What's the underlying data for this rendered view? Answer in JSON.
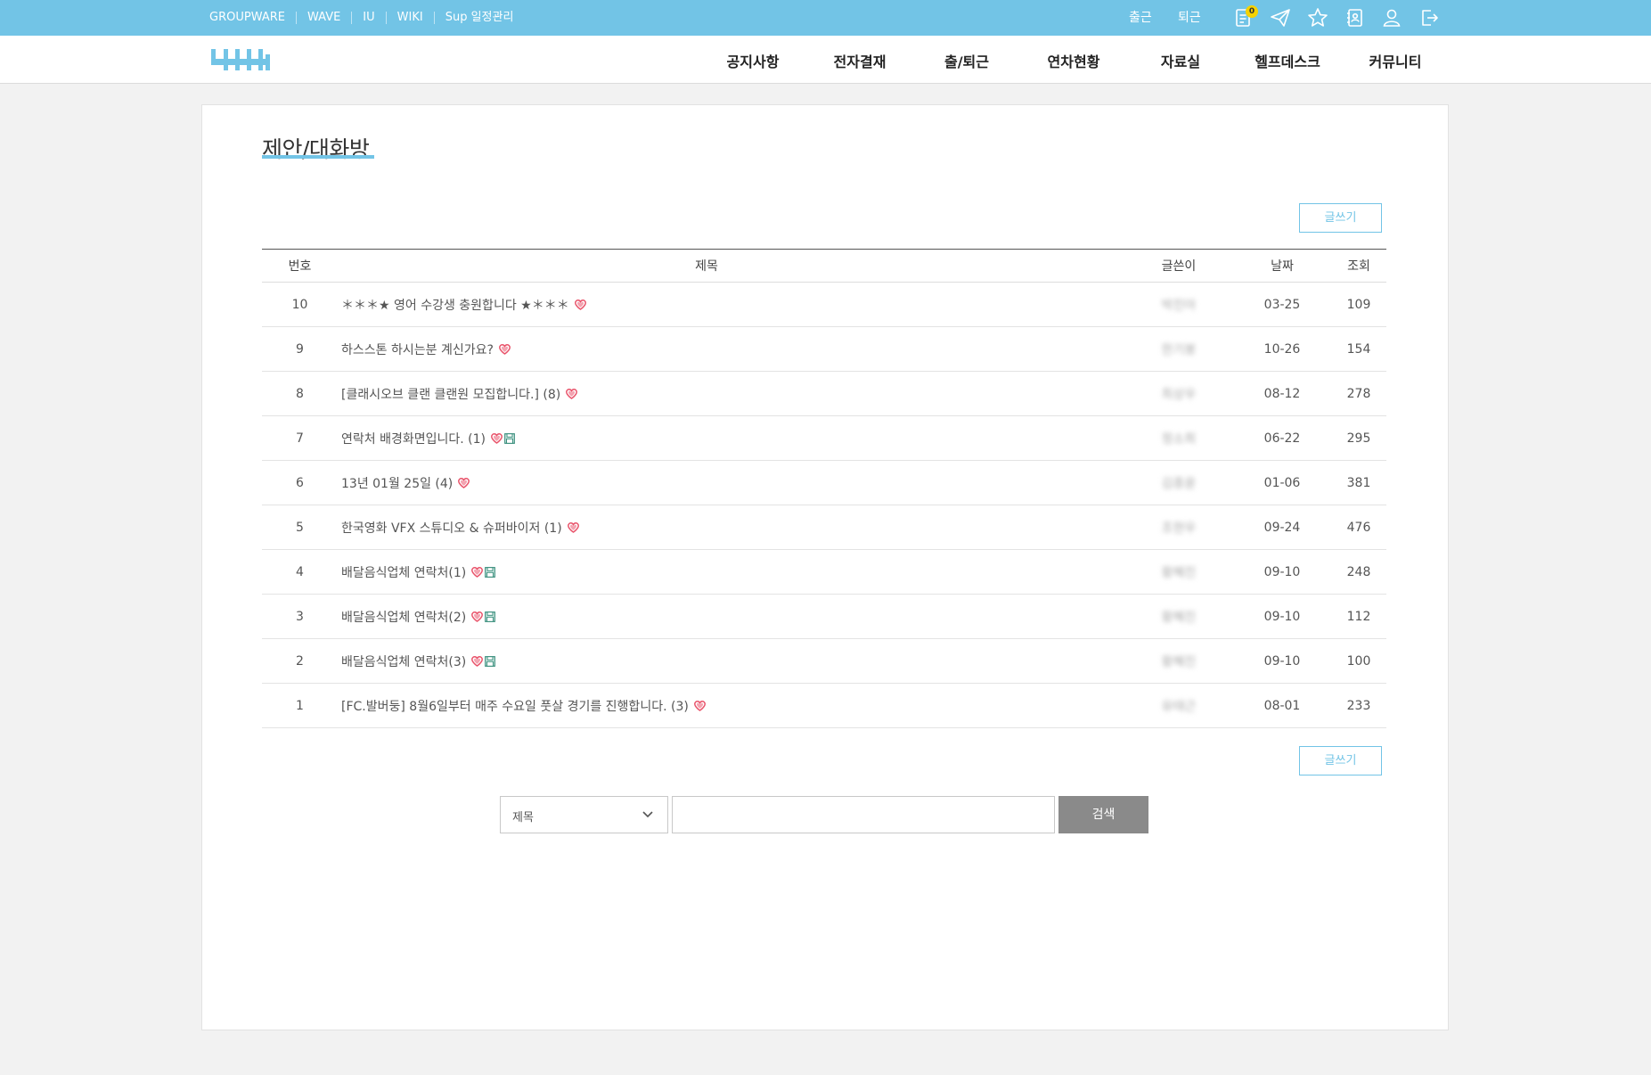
{
  "topbar": {
    "links": [
      "GROUPWARE",
      "WAVE",
      "IU",
      "WIKI",
      "Sup 일정관리"
    ],
    "clock_in": "출근",
    "clock_out": "퇴근",
    "memo_badge": "0",
    "icons": [
      "memo-icon",
      "send-icon",
      "star-icon",
      "address-book-icon",
      "user-icon",
      "logout-icon"
    ]
  },
  "gnb": {
    "items": [
      "공지사항",
      "전자결재",
      "출/퇴근",
      "연차현황",
      "자료실",
      "헬프데스크",
      "커뮤니티"
    ]
  },
  "page": {
    "title": "제안/대화방",
    "write_label": "글쓰기"
  },
  "board": {
    "headers": {
      "num": "번호",
      "title": "제목",
      "author": "글쓴이",
      "date": "날짜",
      "views": "조회"
    },
    "rows": [
      {
        "num": "10",
        "title": "＊＊＊★ 영어 수강생 충원합니다 ★＊＊＊",
        "author": "박진아",
        "date": "03-25",
        "views": "109",
        "attachment": false
      },
      {
        "num": "9",
        "title": "하스스톤 하시는분 계신가요?",
        "author": "한기봉",
        "date": "10-26",
        "views": "154",
        "attachment": false
      },
      {
        "num": "8",
        "title": "[클래시오브 클랜 클랜원 모집합니다.] (8)",
        "author": "최상우",
        "date": "08-12",
        "views": "278",
        "attachment": false
      },
      {
        "num": "7",
        "title": "연락처 배경화면입니다. (1)",
        "author": "정소희",
        "date": "06-22",
        "views": "295",
        "attachment": true
      },
      {
        "num": "6",
        "title": "13년 01월 25일 (4)",
        "author": "김종윤",
        "date": "01-06",
        "views": "381",
        "attachment": false
      },
      {
        "num": "5",
        "title": "한국영화 VFX 스튜디오 & 슈퍼바이저 (1)",
        "author": "조현우",
        "date": "09-24",
        "views": "476",
        "attachment": false
      },
      {
        "num": "4",
        "title": "배달음식업체 연락처(1)",
        "author": "황혜진",
        "date": "09-10",
        "views": "248",
        "attachment": true
      },
      {
        "num": "3",
        "title": "배달음식업체 연락처(2)",
        "author": "황혜진",
        "date": "09-10",
        "views": "112",
        "attachment": true
      },
      {
        "num": "2",
        "title": "배달음식업체 연락처(3)",
        "author": "황혜진",
        "date": "09-10",
        "views": "100",
        "attachment": true
      },
      {
        "num": "1",
        "title": "[FC.발버둥] 8월6일부터 매주 수요일 풋살 경기를 진행합니다. (3)",
        "author": "유태근",
        "date": "08-01",
        "views": "233",
        "attachment": false
      }
    ]
  },
  "search": {
    "field_selected": "제목",
    "query": "",
    "button_label": "검색"
  },
  "colors": {
    "accent": "#72c4e6",
    "heart": "#e9546b",
    "attachment": "#3a8f7d",
    "search_button": "#8a8a8a"
  }
}
